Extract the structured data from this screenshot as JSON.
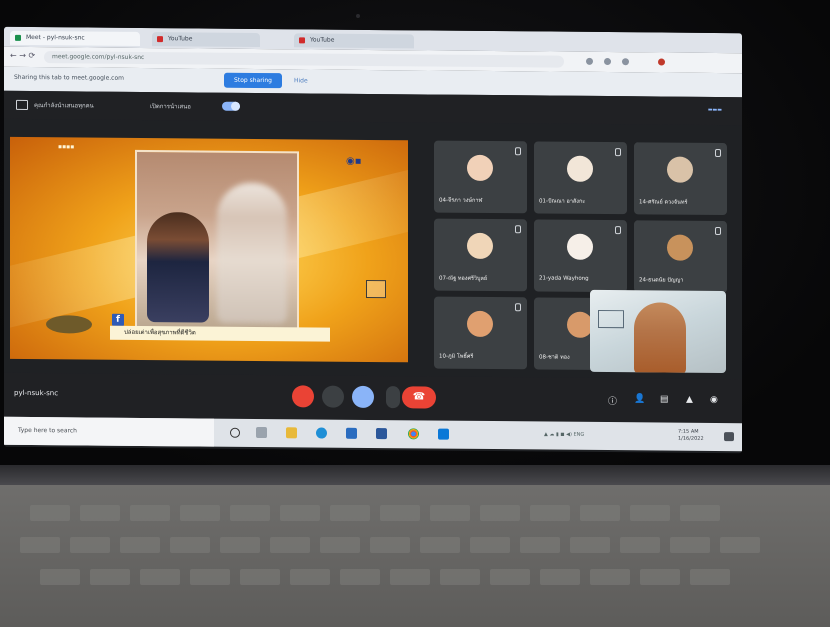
{
  "browser": {
    "tabs": [
      "Meet - pyl-nsuk-snc",
      "YouTube",
      "YouTube"
    ],
    "address": "meet.google.com/pyl-nsuk-snc",
    "sharing_notice": "Sharing this tab to meet.google.com",
    "stop_sharing": "Stop sharing",
    "hide_label": "Hide"
  },
  "meet": {
    "presenting_label": "คุณกำลังนำเสนอทุกคน",
    "toggle_label": "เปิดการนำเสนอ",
    "meeting_code": "pyl-nsuk-snc",
    "presentation": {
      "caption": "ปล่อยเต่าเพื่อสุขภาพที่ดีชีวิต"
    },
    "participants": [
      {
        "name": "04-จีรภา วงษ์กาฬ",
        "color": "#f1d1b8"
      },
      {
        "name": "01-ปัณณา อาสังกะ",
        "color": "#f2e6d8"
      },
      {
        "name": "14-ศรัณย์ ดวงจันทร์",
        "color": "#d9c2a8"
      },
      {
        "name": "07-ณัฐ ทองศรีวิบูลย์",
        "color": "#f0d6b8"
      },
      {
        "name": "21-yada Wayhong",
        "color": "#f6efe8"
      },
      {
        "name": "24-ธนดนัย ปัญญา",
        "color": "#c8925c"
      },
      {
        "name": "10-ภูมิ โพธิ์ศรี",
        "color": "#e0a070"
      },
      {
        "name": "08-ชาติ ทอง",
        "color": "#d89a6a"
      }
    ]
  },
  "taskbar": {
    "search_placeholder": "Type here to search",
    "time": "7:15 AM",
    "date": "1/16/2022"
  }
}
